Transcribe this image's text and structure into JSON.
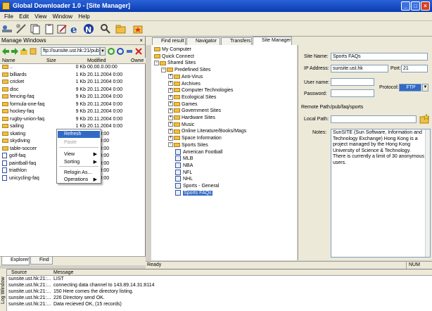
{
  "window": {
    "title": "Global Downloader 1.0 - [Site Manager]",
    "min": "_",
    "max": "□",
    "close": "×"
  },
  "menu": [
    "File",
    "Edit",
    "View",
    "Window",
    "Help"
  ],
  "left": {
    "title": "Manage Windows",
    "path": "ftp://sunsite.ust.hk:21/pub",
    "columns": [
      "Name",
      "Size",
      "Modified",
      "Owne"
    ],
    "files": [
      {
        "name": "..",
        "size": "0 Kb",
        "modified": "00.00.0.00:00",
        "type": "up"
      },
      {
        "name": "billiards",
        "size": "1 Kb",
        "modified": "20.11.2004 0:00",
        "type": "folder"
      },
      {
        "name": "cricket",
        "size": "1 Kb",
        "modified": "20.11.2004 0:00",
        "type": "folder"
      },
      {
        "name": "disc",
        "size": "9 Kb",
        "modified": "20.11.2004 0:00",
        "type": "folder"
      },
      {
        "name": "fencing-faq",
        "size": "9 Kb",
        "modified": "20.11.2004 0:00",
        "type": "folder"
      },
      {
        "name": "formula-one-faq",
        "size": "9 Kb",
        "modified": "20.11.2004 0:00",
        "type": "folder"
      },
      {
        "name": "hockey-faq",
        "size": "9 Kb",
        "modified": "20.11.2004 0:00",
        "type": "folder"
      },
      {
        "name": "rugby-union-faq",
        "size": "9 Kb",
        "modified": "20.11.2004 0:00",
        "type": "folder"
      },
      {
        "name": "sailing",
        "size": "1 Kb",
        "modified": "20.11.2004 0:00",
        "type": "folder"
      },
      {
        "name": "skating",
        "size": "",
        "modified": "2004 0:00",
        "type": "folder"
      },
      {
        "name": "skydiving",
        "size": "",
        "modified": "2004 0:00",
        "type": "folder"
      },
      {
        "name": "table-soccer",
        "size": "",
        "modified": "2004 0:00",
        "type": "folder"
      },
      {
        "name": "golf-faq",
        "size": "",
        "modified": "1998 0:00",
        "type": "file"
      },
      {
        "name": "paintball-faq",
        "size": "",
        "modified": "2004 0:00",
        "type": "file"
      },
      {
        "name": "triathlon",
        "size": "",
        "modified": "2003 0:00",
        "type": "file"
      },
      {
        "name": "unicycling-faq",
        "size": "",
        "modified": "1997 0:00",
        "type": "file"
      }
    ],
    "context_menu": [
      {
        "label": "Refresh",
        "selected": true,
        "disabled": false,
        "submenu": false
      },
      {
        "label": "Paste",
        "selected": false,
        "disabled": true,
        "submenu": false
      },
      {
        "label": "View",
        "selected": false,
        "disabled": false,
        "submenu": true
      },
      {
        "label": "Sorting",
        "selected": false,
        "disabled": false,
        "submenu": true
      },
      {
        "label": "Relogin As...",
        "selected": false,
        "disabled": false,
        "submenu": false
      },
      {
        "label": "Operations",
        "selected": false,
        "disabled": false,
        "submenu": true
      }
    ],
    "bottom_tabs": [
      "Explorer",
      "Find"
    ]
  },
  "tabs": [
    "Find result",
    "Navigator",
    "Transfers",
    "Site Manager"
  ],
  "tree": [
    {
      "label": "My Computer",
      "level": 0
    },
    {
      "label": "Quick Connect",
      "level": 0
    },
    {
      "label": "Shared Sites",
      "level": 0
    },
    {
      "label": "Predefined Sites",
      "level": 1
    },
    {
      "label": "Anti-Virus",
      "level": 2
    },
    {
      "label": "Archives",
      "level": 2
    },
    {
      "label": "Computer Technologies",
      "level": 2
    },
    {
      "label": "Ecological Sites",
      "level": 2
    },
    {
      "label": "Games",
      "level": 2
    },
    {
      "label": "Government Sites",
      "level": 2
    },
    {
      "label": "Hardware Sites",
      "level": 2
    },
    {
      "label": "Music",
      "level": 2
    },
    {
      "label": "Online Literature/Books/Mags",
      "level": 2
    },
    {
      "label": "Space Information",
      "level": 2
    },
    {
      "label": "Sports Sites",
      "level": 2
    },
    {
      "label": "American Football",
      "level": 3
    },
    {
      "label": "MLB",
      "level": 3
    },
    {
      "label": "NBA",
      "level": 3
    },
    {
      "label": "NFL",
      "level": 3
    },
    {
      "label": "NHL",
      "level": 3
    },
    {
      "label": "Sports - General",
      "level": 3
    },
    {
      "label": "Sports FAQs",
      "level": 3,
      "selected": true
    }
  ],
  "form": {
    "site_name_label": "Site Name:",
    "site_name": "Sports FAQs",
    "ip_label": "IP Address:",
    "ip": "sunsite.ust.hk",
    "port_label": "Port:",
    "port": "21",
    "user_label": "User name:",
    "user": "",
    "pass_label": "Password:",
    "pass": "",
    "protocol_label": "Protocol:",
    "protocol": "FTP",
    "remote_label": "Remote Path:",
    "remote": "/pub/faq/sports",
    "local_label": "Local Path:",
    "local": "",
    "notes_label": "Notes:",
    "notes": "SunSITE (Sun Software, Information and Technology Exchange) Hong Kong is a project managed by the Hong Kong University of Science & Technology. There is currently a limit of 30 anonymous users."
  },
  "status": {
    "text": "Ready",
    "num": "NUM"
  },
  "log": {
    "side_label": "Log Window",
    "columns": [
      "Source",
      "Message"
    ],
    "rows": [
      {
        "source": "sunsite.ust.hk:21:...",
        "message": "LIST"
      },
      {
        "source": "sunsite.ust.hk:21:...",
        "message": "connecting data channel to 143.89.14.31:8114"
      },
      {
        "source": "sunsite.ust.hk:21:...",
        "message": "150 Here comes the directory listing."
      },
      {
        "source": "sunsite.ust.hk:21:...",
        "message": "226 Directory send OK."
      },
      {
        "source": "sunsite.ust.hk:21:...",
        "message": "Data recieved OK, (15 records)"
      }
    ]
  }
}
